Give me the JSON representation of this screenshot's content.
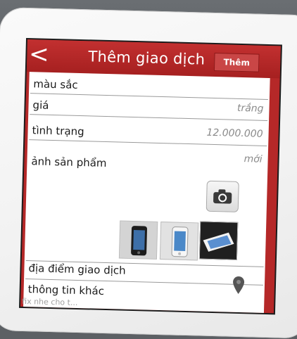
{
  "header": {
    "title": "Thêm giao dịch",
    "back_glyph": "<",
    "add_label": "Thêm"
  },
  "form": {
    "fields": [
      {
        "label": "màu sắc",
        "value": "trắng"
      },
      {
        "label": "giá",
        "value": "12.000.000"
      },
      {
        "label": "tình trạng",
        "value": "mới"
      },
      {
        "label": "ảnh sản phẩm"
      },
      {
        "label": "địa điểm giao dịch"
      },
      {
        "label": "thông tin khác",
        "placeholder": "fix nhe cho t..."
      }
    ]
  },
  "icons": {
    "back": "chevron-left-icon",
    "camera": "camera-icon",
    "location": "map-pin-icon"
  },
  "colors": {
    "accent": "#b52828",
    "header_button": "#c94646"
  }
}
